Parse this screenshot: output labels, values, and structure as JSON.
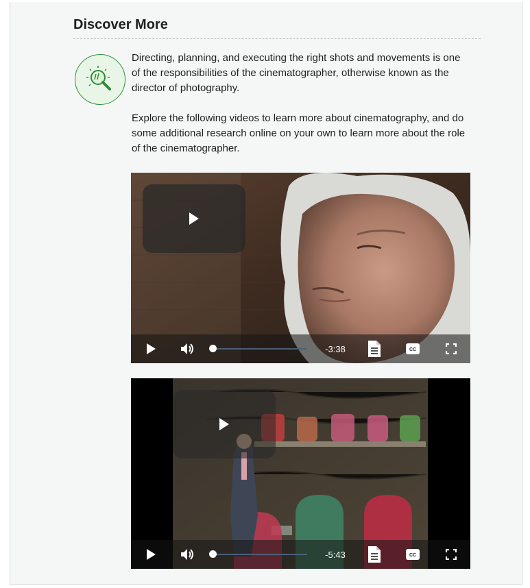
{
  "section": {
    "title": "Discover More",
    "icon": "magnifier-lightbulb-icon",
    "paragraphs": [
      "Directing, planning, and executing the right shots and movements is one of the responsibilities of the cinematographer, otherwise known as the director of photography.",
      "Explore the following videos to learn more about cinematography, and do some additional research online on your own to learn more about the role of the cinematographer."
    ]
  },
  "videos": [
    {
      "time_remaining": "-3:38",
      "progress": 0
    },
    {
      "time_remaining": "-5:43",
      "progress": 0
    }
  ],
  "colors": {
    "accent_green": "#2e8b3a",
    "icon_fill": "#e9f6e7",
    "panel_bg": "#f5f7f6"
  }
}
